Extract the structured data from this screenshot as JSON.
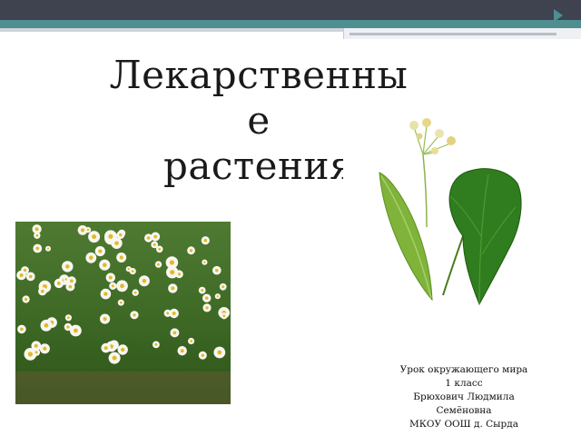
{
  "slide": {
    "title_lines": [
      "Лекарственны",
      "е",
      "растения"
    ],
    "caption_lines": [
      "Урок окружающего мира",
      "1 класс",
      "Брюхович Людмила",
      "Семёновна",
      "МКОУ ООШ д. Сырда"
    ]
  },
  "images": {
    "chamomile": "chamomile-photo",
    "linden": "linden-photo"
  },
  "colors": {
    "header_dark": "#3f4350",
    "header_teal": "#4f8f91",
    "leaf_green": "#2f7d1e"
  }
}
